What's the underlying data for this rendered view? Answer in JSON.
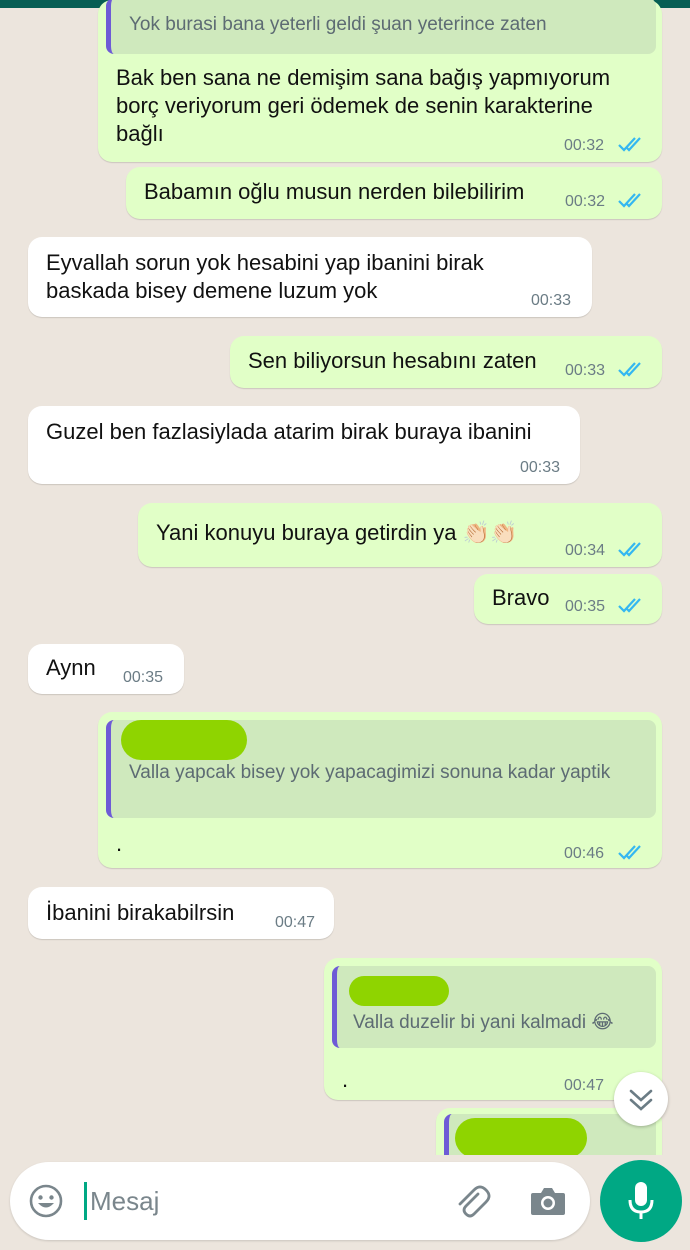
{
  "colors": {
    "outgoing_bubble": "#e1ffc7",
    "incoming_bubble": "#ffffff",
    "read_ticks": "#34b7f1",
    "accent_green": "#00a884",
    "quote_bar": "#6e5bd6"
  },
  "messages": [
    {
      "dir": "out",
      "quote": "Yok burasi bana yeterli geldi şuan yeterince zaten",
      "lines": [
        "Bak ben sana ne demişim sana bağış yapmıyorum",
        "borç veriyorum geri ödemek de senin karakterine",
        "bağlı"
      ],
      "time": "00:32",
      "ticks": "read"
    },
    {
      "dir": "out",
      "lines": [
        "Babamın oğlu musun nerden bilebilirim"
      ],
      "time": "00:32",
      "ticks": "read"
    },
    {
      "dir": "in",
      "lines": [
        "Eyvallah sorun yok hesabini yap ibanini birak",
        "baskada bisey demene luzum yok"
      ],
      "time": "00:33"
    },
    {
      "dir": "out",
      "lines": [
        "Sen biliyorsun hesabını zaten"
      ],
      "time": "00:33",
      "ticks": "read"
    },
    {
      "dir": "in",
      "lines": [
        "Guzel ben fazlasiylada atarim birak buraya ibanini"
      ],
      "time": "00:33"
    },
    {
      "dir": "out",
      "lines": [
        "Yani konuyu buraya getirdin ya 👏🏻👏🏻"
      ],
      "time": "00:34",
      "ticks": "read"
    },
    {
      "dir": "out",
      "lines": [
        "Bravo"
      ],
      "time": "00:35",
      "ticks": "read"
    },
    {
      "dir": "in",
      "lines": [
        "Aynn"
      ],
      "time": "00:35"
    },
    {
      "dir": "out",
      "quote": "Valla yapcak bisey yok yapacagimizi sonuna kadar yaptik",
      "lines": [
        "."
      ],
      "time": "00:46",
      "ticks": "read"
    },
    {
      "dir": "in",
      "lines": [
        "İbanini birakabilrsin"
      ],
      "time": "00:47"
    },
    {
      "dir": "out",
      "quote": "Valla duzelir bi yani kalmadi 😂",
      "lines": [
        "."
      ],
      "time": "00:47",
      "ticks": "read"
    }
  ],
  "composer": {
    "placeholder": "Mesaj",
    "emoji_icon": "emoji-icon",
    "attach_icon": "paperclip-icon",
    "camera_icon": "camera-icon",
    "mic_icon": "microphone-icon"
  },
  "scroll_down_icon": "double-chevron-down-icon"
}
